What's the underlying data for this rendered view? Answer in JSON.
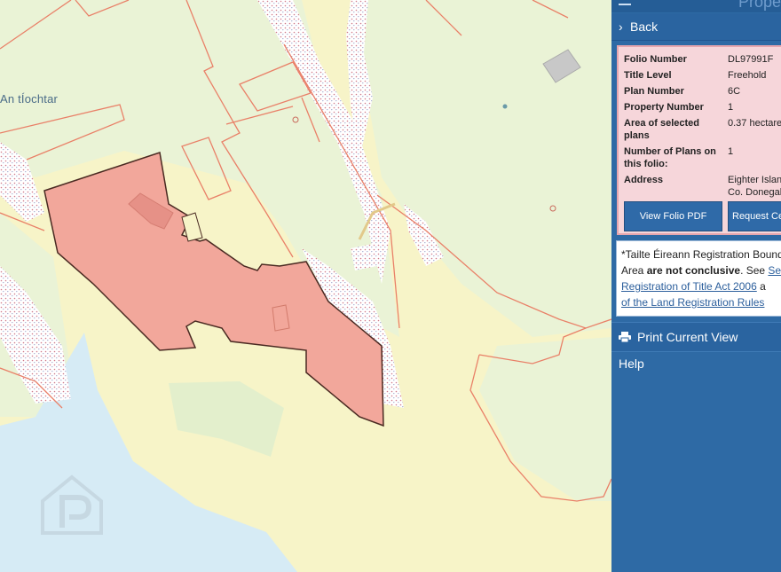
{
  "map": {
    "label": "An tÍochtar",
    "watermark_icon": "property-pal-logo-watermark",
    "colors": {
      "land": "#f7f4c8",
      "green": "#eaf3d6",
      "water": "#d6ebf5",
      "boundary": "#e98068",
      "selected_fill": "#f2a79b",
      "selected_stroke": "#4a2a22"
    }
  },
  "panel": {
    "title": "Prope",
    "back_label": "Back",
    "folio": {
      "rows": [
        {
          "key": "Folio Number",
          "value": "DL97991F"
        },
        {
          "key": "Title Level",
          "value": "Freehold"
        },
        {
          "key": "Plan Number",
          "value": "6C"
        },
        {
          "key": "Property Number",
          "value": "1"
        },
        {
          "key": "Area of selected plans",
          "value": "0.37 hectare"
        },
        {
          "key": "Number of Plans on this folio:",
          "value": "1"
        },
        {
          "key": "Address",
          "value": "Eighter Islan",
          "value2": "Co. Donegal"
        }
      ],
      "view_pdf_label": "View Folio PDF",
      "request_label": "Request Ce"
    },
    "notice": {
      "line1": "*Tailte Éireann Registration Bound",
      "line2_prefix": "Area ",
      "line2_bold": "are not conclusive",
      "line2_suffix": ". See ",
      "line2_link": "Sect",
      "line3_link": "Registration of Title Act 2006",
      "line3_suffix": " a",
      "line4_link": "of the Land Registration Rules"
    },
    "print_label": "Print Current View",
    "help_label": "Help"
  }
}
